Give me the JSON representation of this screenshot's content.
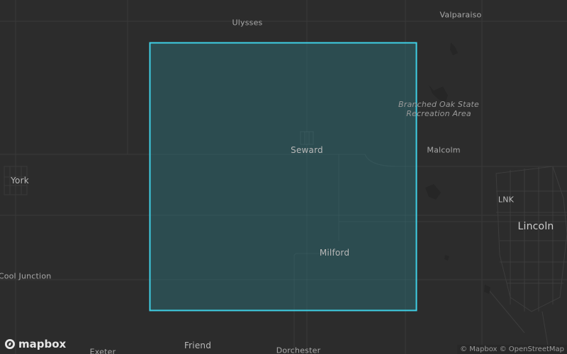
{
  "map": {
    "background": "#2c2c2c",
    "road_color": "#3a3a3a",
    "selection": {
      "stroke": "#3fd0e6",
      "fill": "#2e8a96",
      "fill_opacity": 0.35
    },
    "places": [
      {
        "id": "ulysses",
        "name": "Ulysses",
        "kind": "town"
      },
      {
        "id": "valparaiso",
        "name": "Valparaiso",
        "kind": "town"
      },
      {
        "id": "branched-oak",
        "name": "Branched Oak State\nRecreation Area",
        "kind": "park"
      },
      {
        "id": "seward",
        "name": "Seward",
        "kind": "city-mid"
      },
      {
        "id": "malcolm",
        "name": "Malcolm",
        "kind": "town"
      },
      {
        "id": "york",
        "name": "York",
        "kind": "city-mid"
      },
      {
        "id": "lnk",
        "name": "LNK",
        "kind": "airport"
      },
      {
        "id": "lincoln",
        "name": "Lincoln",
        "kind": "city-big"
      },
      {
        "id": "milford",
        "name": "Milford",
        "kind": "city-mid"
      },
      {
        "id": "mccool-junction",
        "name": "cCool Junction",
        "kind": "town"
      },
      {
        "id": "friend",
        "name": "Friend",
        "kind": "city-mid"
      },
      {
        "id": "exeter",
        "name": "Exeter",
        "kind": "town"
      },
      {
        "id": "dorchester",
        "name": "Dorchester",
        "kind": "town"
      }
    ]
  },
  "branding": {
    "logo_text": "mapbox",
    "attribution": "© Mapbox © OpenStreetMap"
  }
}
